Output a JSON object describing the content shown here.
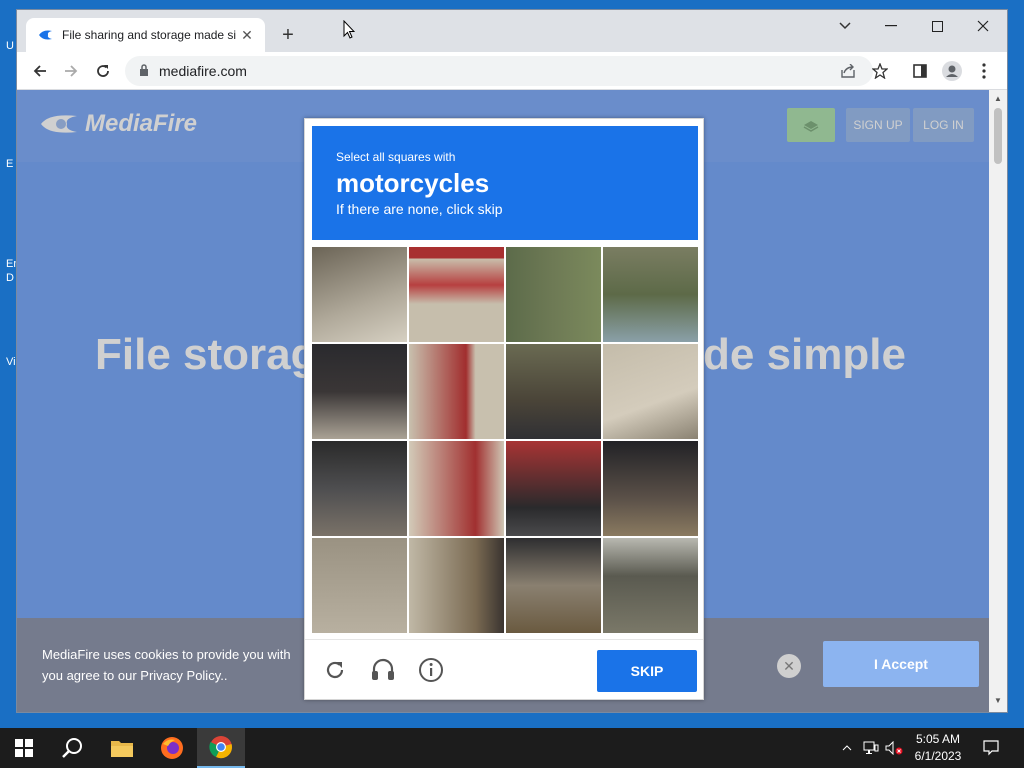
{
  "browser": {
    "tab_title": "File sharing and storage made si",
    "url": "mediafire.com",
    "icons": [
      "back-icon",
      "forward-icon",
      "reload-icon",
      "lock-icon",
      "share-icon",
      "star-icon",
      "sidepanel-icon",
      "profile-icon",
      "menu-icon"
    ]
  },
  "desktop": {
    "labels": [
      "U",
      "E",
      "En",
      "D",
      "Vi"
    ]
  },
  "site": {
    "logo": "MediaFire",
    "sign_up": "SIGN UP",
    "log_in": "LOG IN",
    "hero_left": "File storag",
    "hero_right": "de simple",
    "cookie_line1": "MediaFire uses cookies to provide you with",
    "cookie_line2": "you agree to our Privacy Policy..",
    "cookie_accept": "I Accept"
  },
  "captcha": {
    "line1": "Select all squares with",
    "target": "motorcycles",
    "line3": "If there are none, click skip",
    "skip": "SKIP",
    "accent": "#1a73e8"
  },
  "taskbar": {
    "time": "5:05 AM",
    "date": "6/1/2023"
  }
}
